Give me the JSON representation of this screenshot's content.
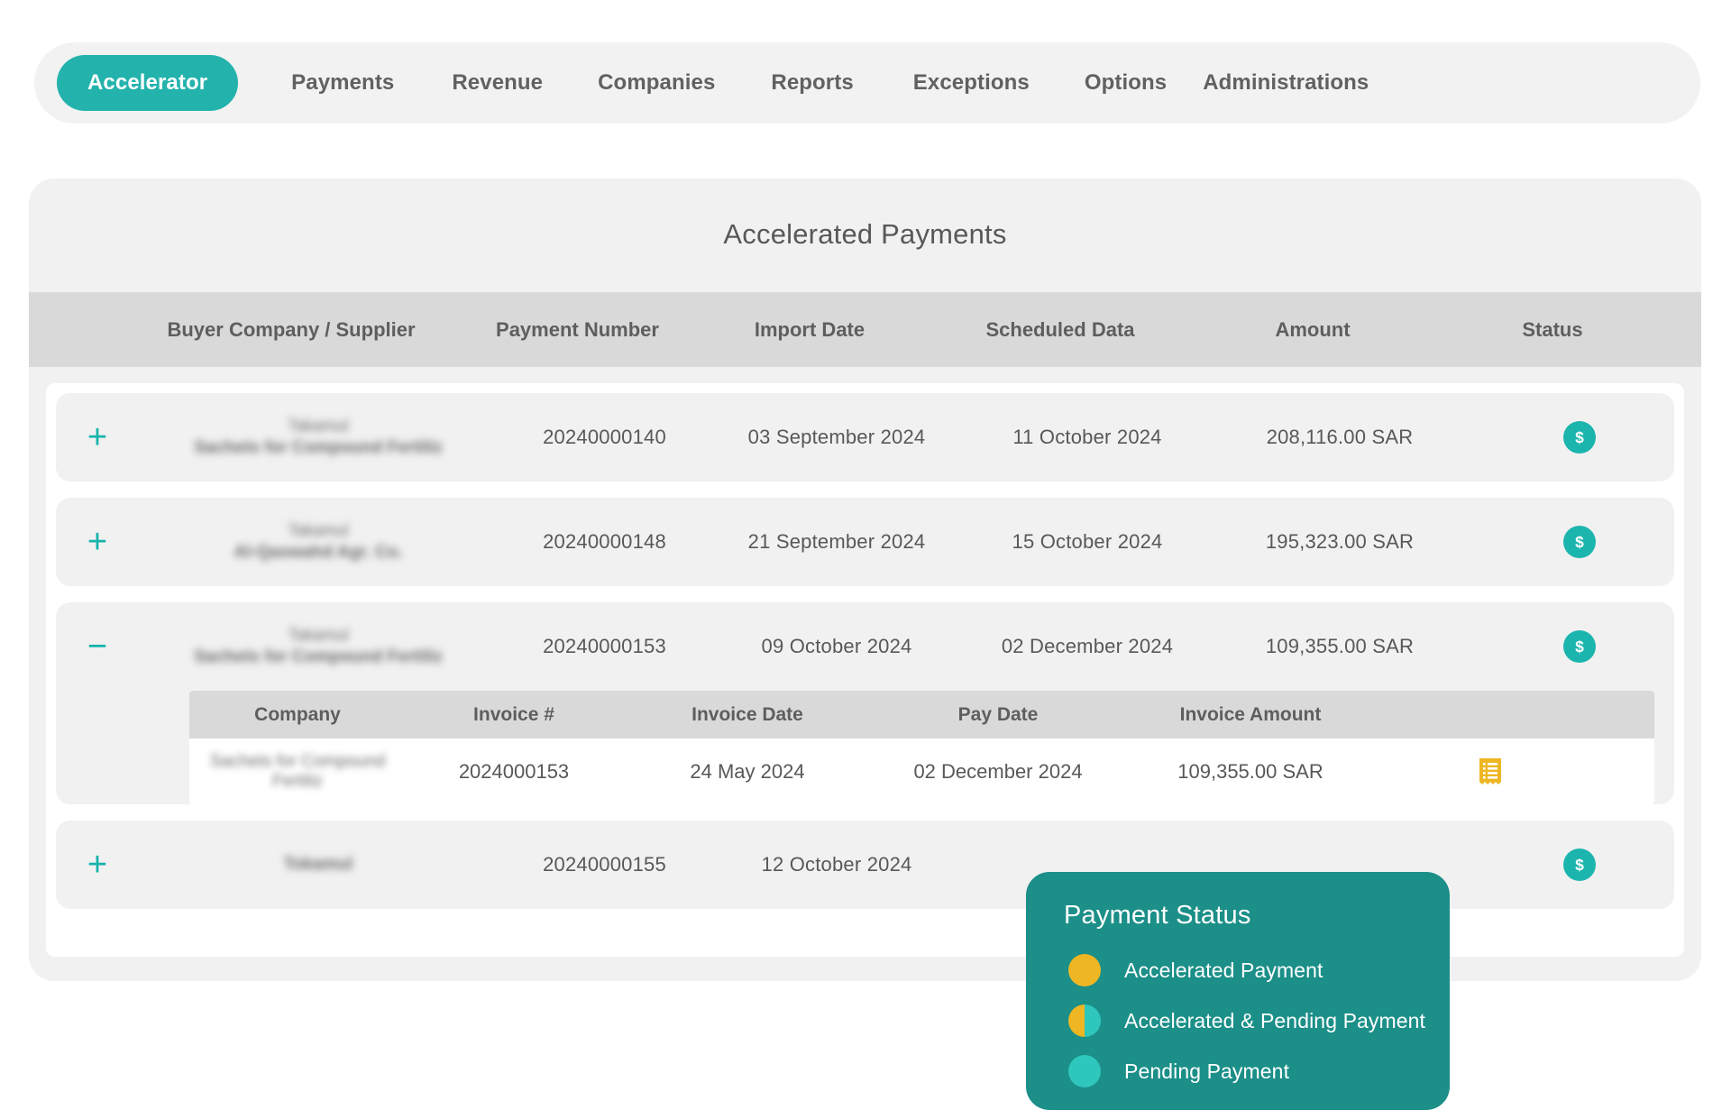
{
  "nav": {
    "items": [
      {
        "label": "Accelerator",
        "active": true
      },
      {
        "label": "Payments",
        "active": false
      },
      {
        "label": "Revenue",
        "active": false
      },
      {
        "label": "Companies",
        "active": false
      },
      {
        "label": "Reports",
        "active": false
      },
      {
        "label": "Exceptions",
        "active": false
      },
      {
        "label": "Options",
        "active": false
      },
      {
        "label": "Administrations",
        "active": false
      }
    ]
  },
  "card": {
    "title": "Accelerated Payments",
    "headers": {
      "toggle": "",
      "company": "Buyer Company / Supplier",
      "payment_number": "Payment Number",
      "import_date": "Import Date",
      "scheduled_date": "Scheduled Data",
      "amount": "Amount",
      "status": "Status"
    }
  },
  "rows": [
    {
      "toggle": "+",
      "expanded": false,
      "company_top": "Takamul",
      "company_bottom": "Sachets for Compound Fertiliz",
      "payment_number": "20240000140",
      "import_date": "03 September 2024",
      "scheduled_date": "11 October 2024",
      "amount": "208,116.00 SAR",
      "status_icon": "dollar-badge-icon"
    },
    {
      "toggle": "+",
      "expanded": false,
      "company_top": "Takamul",
      "company_bottom": "Al-Qaswahd Agr. Co.",
      "payment_number": "20240000148",
      "import_date": "21 September 2024",
      "scheduled_date": "15 October 2024",
      "amount": "195,323.00 SAR",
      "status_icon": "dollar-badge-icon"
    },
    {
      "toggle": "−",
      "expanded": true,
      "company_top": "Takamul",
      "company_bottom": "Sachets for Compound Fertiliz",
      "payment_number": "20240000153",
      "import_date": "09 October 2024",
      "scheduled_date": "02 December 2024",
      "amount": "109,355.00 SAR",
      "status_icon": "dollar-badge-icon"
    },
    {
      "toggle": "+",
      "expanded": false,
      "company_top": "",
      "company_bottom": "Tokamul",
      "payment_number": "20240000155",
      "import_date": "12 October 2024",
      "scheduled_date": "",
      "amount": "",
      "status_icon": "dollar-badge-icon"
    }
  ],
  "subtable": {
    "headers": {
      "company": "Company",
      "invoice_number": "Invoice #",
      "invoice_date": "Invoice Date",
      "pay_date": "Pay Date",
      "invoice_amount": "Invoice Amount",
      "icon": ""
    },
    "rows": [
      {
        "company": "Sachets for Compound Fertiliz",
        "invoice_number": "2024000153",
        "invoice_date": "24 May 2024",
        "pay_date": "02 December 2024",
        "invoice_amount": "109,355.00 SAR",
        "icon": "receipt-icon"
      }
    ]
  },
  "legend": {
    "title": "Payment Status",
    "items": [
      {
        "label": "Accelerated Payment",
        "swatch": "accelerated",
        "color": "#eeb622"
      },
      {
        "label": "Accelerated & Pending Payment",
        "swatch": "split",
        "color": "#eeb622/#2fc6bd"
      },
      {
        "label": "Pending Payment",
        "swatch": "pending",
        "color": "#2fc6bd"
      }
    ]
  },
  "colors": {
    "accent_teal": "#23b3ac",
    "legend_bg": "#1b8f88",
    "amber": "#eeb622",
    "header_grey": "#d9d9d9",
    "card_bg": "#f1f1f1"
  }
}
